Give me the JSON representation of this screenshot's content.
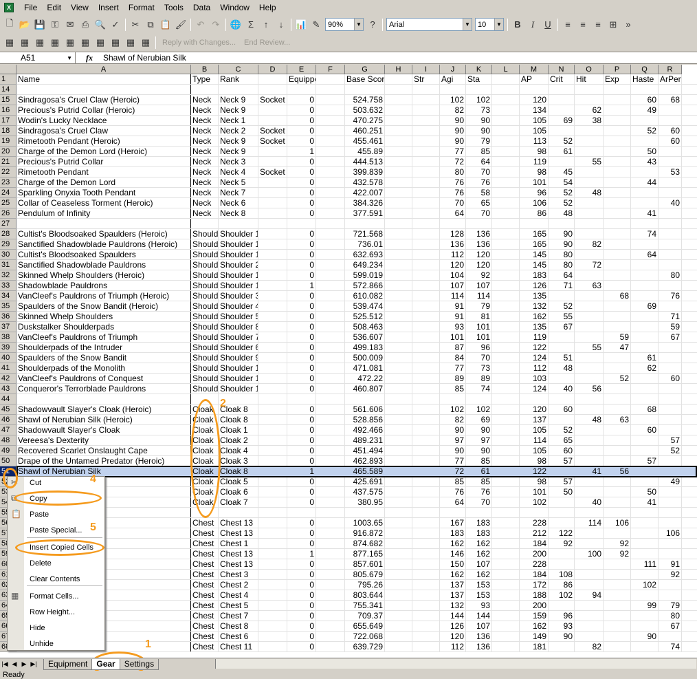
{
  "menu": {
    "app_icon": "X",
    "items": [
      "File",
      "Edit",
      "View",
      "Insert",
      "Format",
      "Tools",
      "Data",
      "Window",
      "Help"
    ]
  },
  "toolbar": {
    "zoom": "90%",
    "font": "Arial",
    "font_size": "10",
    "bold": "B",
    "italic": "I",
    "underline": "U",
    "reply_with_changes": "Reply with Changes...",
    "end_review": "End Review..."
  },
  "formula_bar": {
    "name_box": "A51",
    "fx": "fx",
    "value": "Shawl of Nerubian Silk"
  },
  "columns": [
    "A",
    "B",
    "C",
    "D",
    "E",
    "F",
    "G",
    "H",
    "I",
    "J",
    "K",
    "L",
    "M",
    "N",
    "O",
    "P",
    "Q",
    "R"
  ],
  "header_row": {
    "num": "1",
    "cells": [
      "Name",
      "Type",
      "Rank",
      "",
      "Equipped",
      "",
      "Base Score",
      "",
      "Str",
      "Agi",
      "Sta",
      "",
      "AP",
      "Crit",
      "Hit",
      "Exp",
      "Haste",
      "ArPen"
    ]
  },
  "rows": [
    {
      "n": "14",
      "c": [
        "",
        "",
        "",
        "",
        "",
        "",
        "",
        "",
        "",
        "",
        "",
        "",
        "",
        "",
        "",
        "",
        "",
        ""
      ]
    },
    {
      "n": "15",
      "c": [
        "Sindragosa's Cruel Claw (Heroic)",
        "Neck",
        "Neck 9",
        "Socket",
        "0",
        "",
        "524.758",
        "",
        "",
        "102",
        "102",
        "",
        "120",
        "",
        "",
        "",
        "60",
        "68"
      ]
    },
    {
      "n": "16",
      "c": [
        "Precious's Putrid Collar (Heroic)",
        "Neck",
        "Neck 9",
        "",
        "0",
        "",
        "503.632",
        "",
        "",
        "82",
        "73",
        "",
        "134",
        "",
        "62",
        "",
        "49",
        ""
      ]
    },
    {
      "n": "17",
      "c": [
        "Wodin's Lucky Necklace",
        "Neck",
        "Neck 1",
        "",
        "0",
        "",
        "470.275",
        "",
        "",
        "90",
        "90",
        "",
        "105",
        "69",
        "38",
        "",
        "",
        ""
      ]
    },
    {
      "n": "18",
      "c": [
        "Sindragosa's Cruel Claw",
        "Neck",
        "Neck 2",
        "Socket",
        "0",
        "",
        "460.251",
        "",
        "",
        "90",
        "90",
        "",
        "105",
        "",
        "",
        "",
        "52",
        "60"
      ]
    },
    {
      "n": "19",
      "c": [
        "Rimetooth Pendant (Heroic)",
        "Neck",
        "Neck 9",
        "Socket",
        "0",
        "",
        "455.461",
        "",
        "",
        "90",
        "79",
        "",
        "113",
        "52",
        "",
        "",
        "",
        "60"
      ]
    },
    {
      "n": "20",
      "c": [
        "Charge of the Demon Lord (Heroic)",
        "Neck",
        "Neck 9",
        "",
        "1",
        "",
        "455.89",
        "",
        "",
        "77",
        "85",
        "",
        "98",
        "61",
        "",
        "",
        "50",
        ""
      ]
    },
    {
      "n": "21",
      "c": [
        "Precious's Putrid Collar",
        "Neck",
        "Neck 3",
        "",
        "0",
        "",
        "444.513",
        "",
        "",
        "72",
        "64",
        "",
        "119",
        "",
        "55",
        "",
        "43",
        ""
      ]
    },
    {
      "n": "22",
      "c": [
        "Rimetooth Pendant",
        "Neck",
        "Neck 4",
        "Socket",
        "0",
        "",
        "399.839",
        "",
        "",
        "80",
        "70",
        "",
        "98",
        "45",
        "",
        "",
        "",
        "53"
      ]
    },
    {
      "n": "23",
      "c": [
        "Charge of the Demon Lord",
        "Neck",
        "Neck 5",
        "",
        "0",
        "",
        "432.578",
        "",
        "",
        "76",
        "76",
        "",
        "101",
        "54",
        "",
        "",
        "44",
        ""
      ]
    },
    {
      "n": "24",
      "c": [
        "Sparkling Onyxia Tooth Pendant",
        "Neck",
        "Neck 7",
        "",
        "0",
        "",
        "422.007",
        "",
        "",
        "76",
        "58",
        "",
        "96",
        "52",
        "48",
        "",
        "",
        ""
      ]
    },
    {
      "n": "25",
      "c": [
        "Collar of Ceaseless Torment (Heroic)",
        "Neck",
        "Neck 6",
        "",
        "0",
        "",
        "384.326",
        "",
        "",
        "70",
        "65",
        "",
        "106",
        "52",
        "",
        "",
        "",
        "40"
      ]
    },
    {
      "n": "26",
      "c": [
        "Pendulum of Infinity",
        "Neck",
        "Neck 8",
        "",
        "0",
        "",
        "377.591",
        "",
        "",
        "64",
        "70",
        "",
        "86",
        "48",
        "",
        "",
        "41",
        ""
      ]
    },
    {
      "n": "27",
      "c": [
        "",
        "",
        "",
        "",
        "",
        "",
        "",
        "",
        "",
        "",
        "",
        "",
        "",
        "",
        "",
        "",
        "",
        ""
      ]
    },
    {
      "n": "28",
      "c": [
        "Cultist's Bloodsoaked Spaulders (Heroic)",
        "Should",
        "Shoulder 13",
        "",
        "0",
        "",
        "721.568",
        "",
        "",
        "128",
        "136",
        "",
        "165",
        "90",
        "",
        "",
        "74",
        ""
      ]
    },
    {
      "n": "29",
      "c": [
        "Sanctified Shadowblade Pauldrons (Heroic)",
        "Should",
        "Shoulder 13",
        "",
        "0",
        "",
        "736.01",
        "",
        "",
        "136",
        "136",
        "",
        "165",
        "90",
        "82",
        "",
        "",
        ""
      ]
    },
    {
      "n": "30",
      "c": [
        "Cultist's Bloodsoaked Spaulders",
        "Should",
        "Shoulder 1",
        "",
        "0",
        "",
        "632.693",
        "",
        "",
        "112",
        "120",
        "",
        "145",
        "80",
        "",
        "",
        "64",
        ""
      ]
    },
    {
      "n": "31",
      "c": [
        "Sanctified Shadowblade Pauldrons",
        "Should",
        "Shoulder 2",
        "",
        "0",
        "",
        "649.234",
        "",
        "",
        "120",
        "120",
        "",
        "145",
        "80",
        "72",
        "",
        "",
        ""
      ]
    },
    {
      "n": "32",
      "c": [
        "Skinned Whelp Shoulders (Heroic)",
        "Should",
        "Shoulder 13",
        "",
        "0",
        "",
        "599.019",
        "",
        "",
        "104",
        "92",
        "",
        "183",
        "64",
        "",
        "",
        "",
        "80"
      ]
    },
    {
      "n": "33",
      "c": [
        "Shadowblade Pauldrons",
        "Should",
        "Shoulder 13",
        "",
        "1",
        "",
        "572.866",
        "",
        "",
        "107",
        "107",
        "",
        "126",
        "71",
        "63",
        "",
        "",
        ""
      ]
    },
    {
      "n": "34",
      "c": [
        "VanCleef's Pauldrons of Triumph (Heroic)",
        "Should",
        "Shoulder 3",
        "",
        "0",
        "",
        "610.082",
        "",
        "",
        "114",
        "114",
        "",
        "135",
        "",
        "",
        "68",
        "",
        "76"
      ]
    },
    {
      "n": "35",
      "c": [
        "Spaulders of the Snow Bandit (Heroic)",
        "Should",
        "Shoulder 4",
        "",
        "0",
        "",
        "539.474",
        "",
        "",
        "91",
        "79",
        "",
        "132",
        "52",
        "",
        "",
        "69",
        ""
      ]
    },
    {
      "n": "36",
      "c": [
        "Skinned Whelp Shoulders",
        "Should",
        "Shoulder 5",
        "",
        "0",
        "",
        "525.512",
        "",
        "",
        "91",
        "81",
        "",
        "162",
        "55",
        "",
        "",
        "",
        "71"
      ]
    },
    {
      "n": "37",
      "c": [
        "Duskstalker Shoulderpads",
        "Should",
        "Shoulder 8",
        "",
        "0",
        "",
        "508.463",
        "",
        "",
        "93",
        "101",
        "",
        "135",
        "67",
        "",
        "",
        "",
        "59"
      ]
    },
    {
      "n": "38",
      "c": [
        "VanCleef's Pauldrons of Triumph",
        "Should",
        "Shoulder 7",
        "",
        "0",
        "",
        "536.607",
        "",
        "",
        "101",
        "101",
        "",
        "119",
        "",
        "",
        "59",
        "",
        "67"
      ]
    },
    {
      "n": "39",
      "c": [
        "Shoulderpads of the Intruder",
        "Should",
        "Shoulder 6",
        "",
        "0",
        "",
        "499.183",
        "",
        "",
        "87",
        "96",
        "",
        "122",
        "",
        "55",
        "47",
        "",
        ""
      ]
    },
    {
      "n": "40",
      "c": [
        "Spaulders of the Snow Bandit",
        "Should",
        "Shoulder 9",
        "",
        "0",
        "",
        "500.009",
        "",
        "",
        "84",
        "70",
        "",
        "124",
        "51",
        "",
        "",
        "61",
        ""
      ]
    },
    {
      "n": "41",
      "c": [
        "Shoulderpads of the Monolith",
        "Should",
        "Shoulder 10",
        "",
        "0",
        "",
        "471.081",
        "",
        "",
        "77",
        "73",
        "",
        "112",
        "48",
        "",
        "",
        "62",
        ""
      ]
    },
    {
      "n": "42",
      "c": [
        "VanCleef's Pauldrons of Conquest",
        "Should",
        "Shoulder 11",
        "",
        "0",
        "",
        "472.22",
        "",
        "",
        "89",
        "89",
        "",
        "103",
        "",
        "",
        "52",
        "",
        "60"
      ]
    },
    {
      "n": "43",
      "c": [
        "Conqueror's Terrorblade Pauldrons",
        "Should",
        "Shoulder 12",
        "",
        "0",
        "",
        "460.807",
        "",
        "",
        "85",
        "74",
        "",
        "124",
        "40",
        "56",
        "",
        "",
        ""
      ]
    },
    {
      "n": "44",
      "c": [
        "",
        "",
        "",
        "",
        "",
        "",
        "",
        "",
        "",
        "",
        "",
        "",
        "",
        "",
        "",
        "",
        "",
        ""
      ]
    },
    {
      "n": "45",
      "c": [
        "Shadowvault Slayer's Cloak (Heroic)",
        "Cloak",
        "Cloak 8",
        "",
        "0",
        "",
        "561.606",
        "",
        "",
        "102",
        "102",
        "",
        "120",
        "60",
        "",
        "",
        "68",
        ""
      ]
    },
    {
      "n": "46",
      "c": [
        "Shawl of Nerubian Silk (Heroic)",
        "Cloak",
        "Cloak 8",
        "",
        "0",
        "",
        "528.856",
        "",
        "",
        "82",
        "69",
        "",
        "137",
        "",
        "48",
        "63",
        "",
        ""
      ]
    },
    {
      "n": "47",
      "c": [
        "Shadowvault Slayer's Cloak",
        "Cloak",
        "Cloak 1",
        "",
        "0",
        "",
        "492.466",
        "",
        "",
        "90",
        "90",
        "",
        "105",
        "52",
        "",
        "",
        "60",
        ""
      ]
    },
    {
      "n": "48",
      "c": [
        "Vereesa's Dexterity",
        "Cloak",
        "Cloak 2",
        "",
        "0",
        "",
        "489.231",
        "",
        "",
        "97",
        "97",
        "",
        "114",
        "65",
        "",
        "",
        "",
        "57"
      ]
    },
    {
      "n": "49",
      "c": [
        "Recovered Scarlet Onslaught Cape",
        "Cloak",
        "Cloak 4",
        "",
        "0",
        "",
        "451.494",
        "",
        "",
        "90",
        "90",
        "",
        "105",
        "60",
        "",
        "",
        "",
        "52"
      ]
    },
    {
      "n": "50",
      "c": [
        "Drape of the Untamed Predator (Heroic)",
        "Cloak",
        "Cloak 3",
        "",
        "0",
        "",
        "462.893",
        "",
        "",
        "77",
        "85",
        "",
        "98",
        "57",
        "",
        "",
        "57",
        ""
      ]
    },
    {
      "n": "51",
      "c": [
        "Shawl of Nerubian Silk",
        "Cloak",
        "Cloak 8",
        "",
        "1",
        "",
        "465.589",
        "",
        "",
        "72",
        "61",
        "",
        "122",
        "",
        "41",
        "56",
        "",
        ""
      ]
    },
    {
      "n": "52",
      "c": [
        "",
        "Cloak",
        "Cloak 5",
        "",
        "0",
        "",
        "425.691",
        "",
        "",
        "85",
        "85",
        "",
        "98",
        "57",
        "",
        "",
        "",
        "49"
      ]
    },
    {
      "n": "53",
      "c": [
        "",
        "Cloak",
        "Cloak 6",
        "",
        "0",
        "",
        "437.575",
        "",
        "",
        "76",
        "76",
        "",
        "101",
        "50",
        "",
        "",
        "50",
        ""
      ]
    },
    {
      "n": "54",
      "c": [
        "",
        "Cloak",
        "Cloak 7",
        "",
        "0",
        "",
        "380.95",
        "",
        "",
        "64",
        "70",
        "",
        "102",
        "",
        "40",
        "",
        "41",
        ""
      ]
    },
    {
      "n": "55",
      "c": [
        "",
        "",
        "",
        "",
        "",
        "",
        "",
        "",
        "",
        "",
        "",
        "",
        "",
        "",
        "",
        "",
        "",
        ""
      ]
    },
    {
      "n": "56",
      "c": [
        "r (Heroic)",
        "Chest",
        "Chest 13",
        "",
        "0",
        "",
        "1003.65",
        "",
        "",
        "167",
        "183",
        "",
        "228",
        "",
        "114",
        "106",
        "",
        ""
      ]
    },
    {
      "n": "57",
      "c": [
        "e Breastplate (Heroic)",
        "Chest",
        "Chest 13",
        "",
        "0",
        "",
        "916.872",
        "",
        "",
        "183",
        "183",
        "",
        "212",
        "122",
        "",
        "",
        "",
        "106"
      ]
    },
    {
      "n": "58",
      "c": [
        "",
        "Chest",
        "Chest 1",
        "",
        "0",
        "",
        "874.682",
        "",
        "",
        "162",
        "162",
        "",
        "184",
        "92",
        "",
        "92",
        "",
        ""
      ]
    },
    {
      "n": "59",
      "c": [
        "r",
        "Chest",
        "Chest 13",
        "",
        "1",
        "",
        "877.165",
        "",
        "",
        "146",
        "162",
        "",
        "200",
        "",
        "100",
        "92",
        "",
        ""
      ]
    },
    {
      "n": "60",
      "c": [
        "d Noose (Heroic)",
        "Chest",
        "Chest 13",
        "",
        "0",
        "",
        "857.601",
        "",
        "",
        "150",
        "107",
        "",
        "228",
        "",
        "",
        "",
        "111",
        "91"
      ]
    },
    {
      "n": "61",
      "c": [
        "e Breastplate",
        "Chest",
        "Chest 3",
        "",
        "0",
        "",
        "805.679",
        "",
        "",
        "162",
        "162",
        "",
        "184",
        "108",
        "",
        "",
        "",
        "92"
      ]
    },
    {
      "n": "62",
      "c": [
        "Fate (Heroic)",
        "Chest",
        "Chest 2",
        "",
        "0",
        "",
        "795.26",
        "",
        "",
        "137",
        "153",
        "",
        "172",
        "86",
        "",
        "",
        "102",
        ""
      ]
    },
    {
      "n": "63",
      "c": [
        "of Triumph (Heroic)",
        "Chest",
        "Chest 4",
        "",
        "0",
        "",
        "803.644",
        "",
        "",
        "137",
        "153",
        "",
        "188",
        "102",
        "94",
        "",
        "",
        ""
      ]
    },
    {
      "n": "64",
      "c": [
        "d Noose",
        "Chest",
        "Chest 5",
        "",
        "0",
        "",
        "755.341",
        "",
        "",
        "132",
        "93",
        "",
        "200",
        "",
        "",
        "",
        "99",
        "79"
      ]
    },
    {
      "n": "65",
      "c": [
        "ate",
        "Chest",
        "Chest 7",
        "",
        "0",
        "",
        "709.37",
        "",
        "",
        "144",
        "144",
        "",
        "159",
        "96",
        "",
        "",
        "",
        "80"
      ]
    },
    {
      "n": "66",
      "c": [
        "ws (Heroic)",
        "Chest",
        "Chest 8",
        "",
        "0",
        "",
        "655.649",
        "",
        "",
        "126",
        "107",
        "",
        "162",
        "93",
        "",
        "",
        "",
        "67"
      ]
    },
    {
      "n": "67",
      "c": [
        "Fate",
        "Chest",
        "Chest 6",
        "",
        "0",
        "",
        "722.068",
        "",
        "",
        "120",
        "136",
        "",
        "149",
        "90",
        "",
        "",
        "90",
        ""
      ]
    },
    {
      "n": "68",
      "c": [
        "",
        "Chest",
        "Chest 11",
        "",
        "0",
        "",
        "639.729",
        "",
        "",
        "112",
        "136",
        "",
        "181",
        "",
        "82",
        "",
        "",
        "74"
      ]
    }
  ],
  "context_menu": [
    {
      "label": "Cut",
      "icon": "scissors-icon"
    },
    {
      "label": "Copy",
      "icon": "copy-icon"
    },
    {
      "label": "Paste",
      "icon": "paste-icon"
    },
    {
      "label": "Paste Special...",
      "icon": ""
    },
    {
      "label": "Insert Copied Cells",
      "icon": ""
    },
    {
      "label": "Delete",
      "icon": ""
    },
    {
      "label": "Clear Contents",
      "icon": ""
    },
    {
      "label": "Format Cells...",
      "icon": "format-cells-icon"
    },
    {
      "label": "Row Height...",
      "icon": ""
    },
    {
      "label": "Hide",
      "icon": ""
    },
    {
      "label": "Unhide",
      "icon": ""
    }
  ],
  "annotations": [
    "1",
    "2",
    "4",
    "5"
  ],
  "sheet_tabs": [
    "Equipment",
    "Gear",
    "Settings"
  ],
  "active_tab": "Gear",
  "status": "Ready",
  "colors": {
    "annotation": "#f59b1e",
    "selection": "#c1d2ee",
    "row_header_selected": "#0a246a"
  }
}
